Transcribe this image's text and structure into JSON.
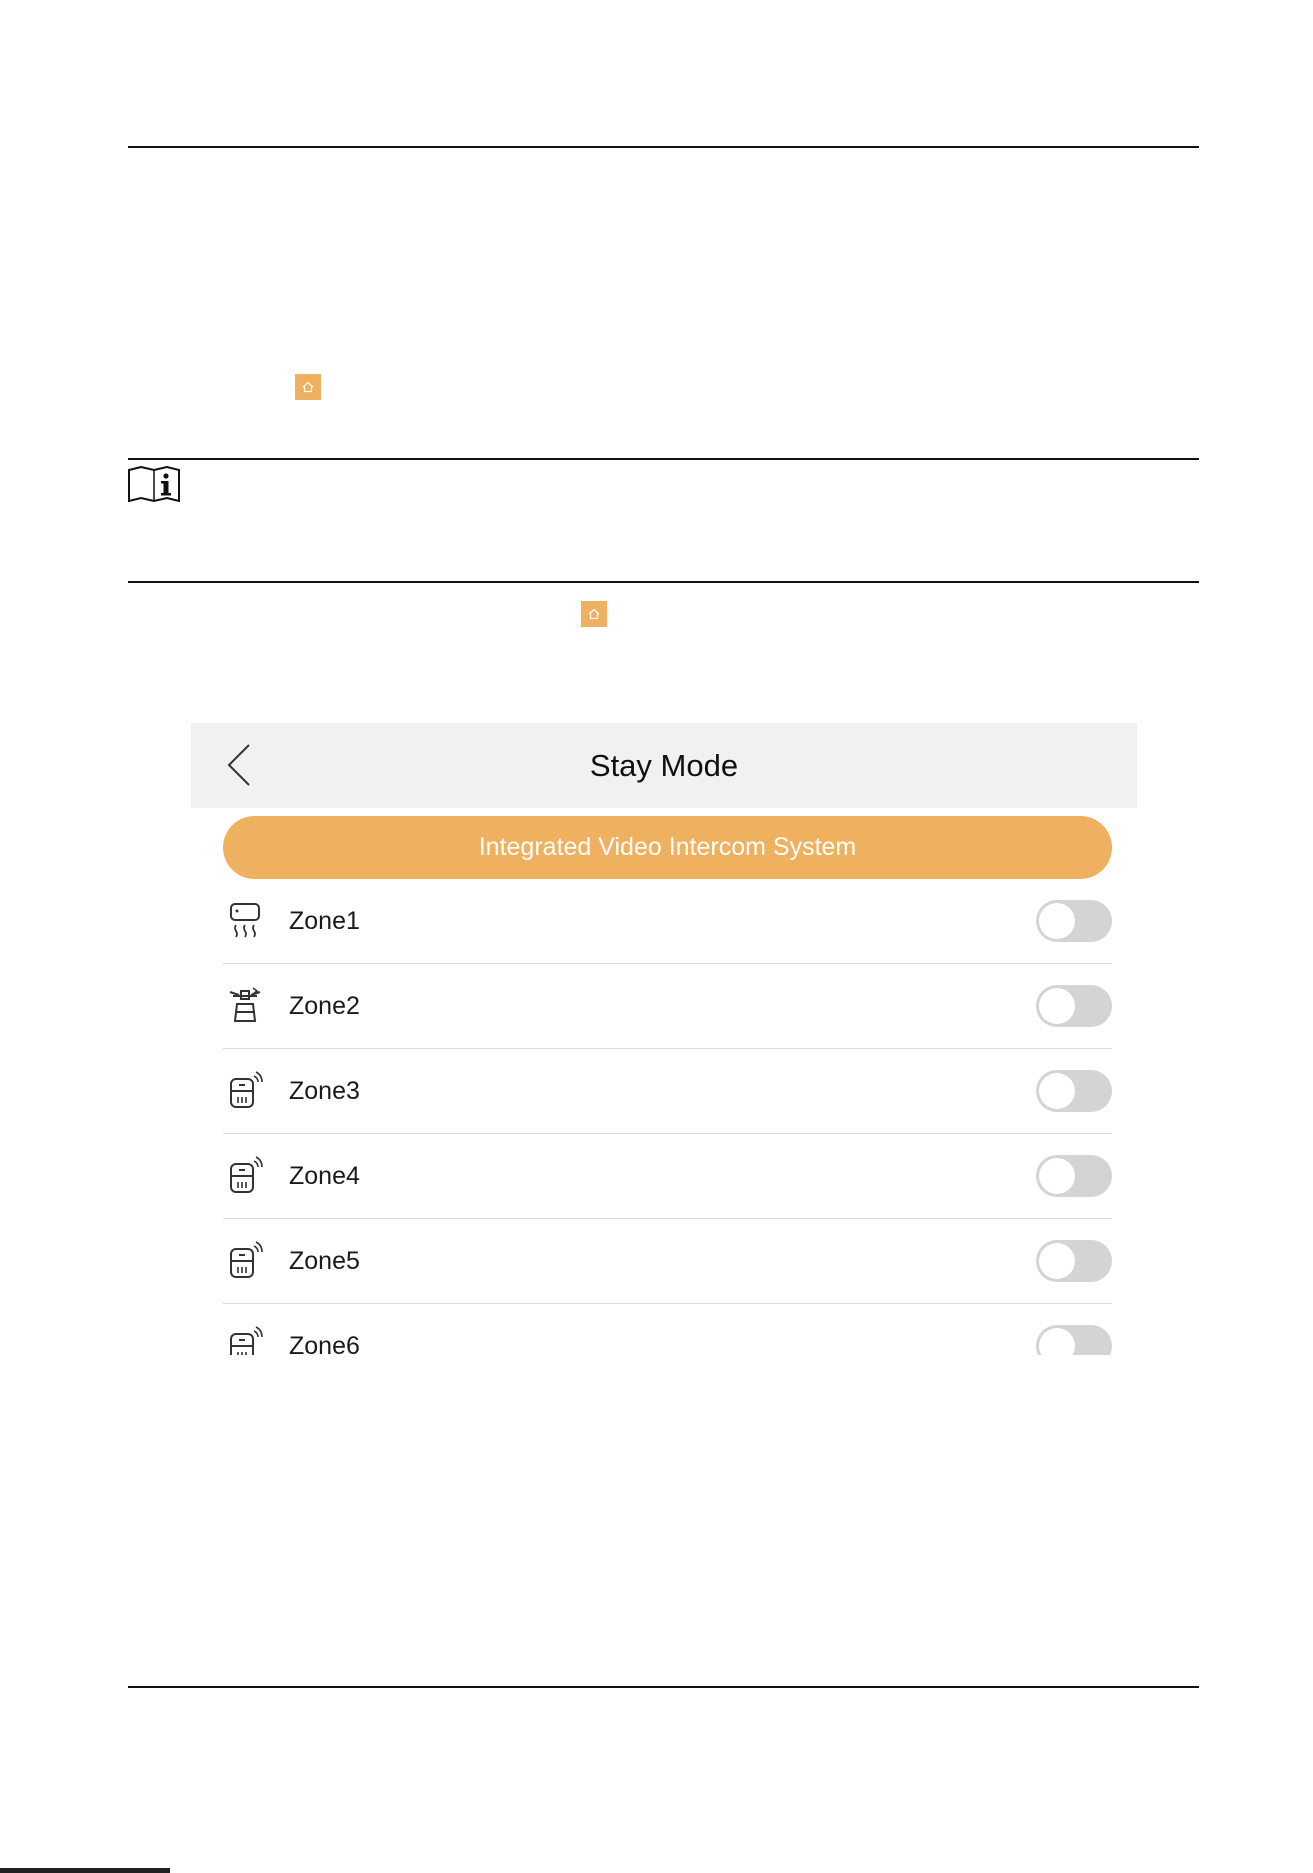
{
  "phone": {
    "title": "Stay Mode",
    "banner": "Integrated Video Intercom System",
    "zones": [
      {
        "label": "Zone1",
        "icon": "heater-icon",
        "enabled": false
      },
      {
        "label": "Zone2",
        "icon": "gas-stove-icon",
        "enabled": false
      },
      {
        "label": "Zone3",
        "icon": "wireless-detector-icon",
        "enabled": false
      },
      {
        "label": "Zone4",
        "icon": "wireless-detector-icon",
        "enabled": false
      },
      {
        "label": "Zone5",
        "icon": "wireless-detector-icon",
        "enabled": false
      },
      {
        "label": "Zone6",
        "icon": "wireless-detector-icon",
        "enabled": false
      }
    ]
  },
  "colors": {
    "accent": "#efb060",
    "header_bg": "#f1f1f1",
    "toggle_off": "#d4d4d4"
  }
}
